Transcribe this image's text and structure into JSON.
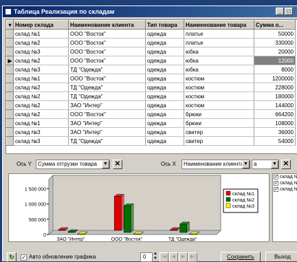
{
  "window": {
    "title": "Таблица Реализация по складам",
    "min": "_",
    "max": "□",
    "close": "×"
  },
  "grid": {
    "columns": [
      "Номер склада",
      "Наименование клиента",
      "Тип товара",
      "Наименование товара",
      "Сумма о..."
    ],
    "rows": [
      [
        "склад №1",
        "ООО \"Восток\"",
        "одежда",
        "платье",
        "50000"
      ],
      [
        "склад №2",
        "ООО \"Восток\"",
        "одежда",
        "платье",
        "330000"
      ],
      [
        "склад №3",
        "ООО \"Восток\"",
        "одежда",
        "юбка",
        "20000"
      ],
      [
        "склад №2",
        "ООО \"Восток\"",
        "одежда",
        "юбка",
        "12000"
      ],
      [
        "склад №3",
        "ТД \"Одежда\"",
        "одежда",
        "юбка",
        "8000"
      ],
      [
        "склад №1",
        "ООО \"Восток\"",
        "одежда",
        "костюм",
        "1200000"
      ],
      [
        "склад №2",
        "ТД \"Одежда\"",
        "одежда",
        "костюм",
        "228000"
      ],
      [
        "склад №2",
        "ТД \"Одежда\"",
        "одежда",
        "костюм",
        "180000"
      ],
      [
        "склад №2",
        "ЗАО \"Интер\"",
        "одежда",
        "костюм",
        "144000"
      ],
      [
        "склад №2",
        "ООО \"Восток\"",
        "одежда",
        "брюки",
        "664200"
      ],
      [
        "склад №1",
        "ЗАО \"Интер\"",
        "одежда",
        "брюки",
        "108000"
      ],
      [
        "склад №3",
        "ЗАО \"Интер\"",
        "одежда",
        "свитер",
        "36000"
      ],
      [
        "склад №3",
        "ТД \"Одежда\"",
        "одежда",
        "свитер",
        "54000"
      ]
    ],
    "selected_row": 3
  },
  "axes_controls": {
    "y_label": "Ось Y",
    "y_value": "Сумма отгрузки товара",
    "x_label": "Ось X",
    "x_value": "Наименование клиента",
    "third_value": "а"
  },
  "chart_data": {
    "type": "bar",
    "categories": [
      "ЗАО \"Интер\"",
      "ООО \"Восток\"",
      "ТД \"Одежда\""
    ],
    "series": [
      {
        "name": "склад №1",
        "color": "#e00000",
        "values": [
          108000,
          1250000,
          0
        ]
      },
      {
        "name": "склад №2",
        "color": "#007000",
        "values": [
          144000,
          1006200,
          408000
        ]
      },
      {
        "name": "склад №3",
        "color": "#ffff00",
        "values": [
          36000,
          20000,
          62000
        ]
      }
    ],
    "yticks": [
      "0",
      "500 000",
      "1 000 000",
      "1 500 000"
    ],
    "ylim": [
      0,
      1800000
    ]
  },
  "series_list": [
    "склад №1",
    "склад №2",
    "склад №3"
  ],
  "bottom": {
    "auto_update": "Авто обновление графика",
    "spin_value": "0",
    "save": "Сохранить",
    "exit": "Выход"
  }
}
